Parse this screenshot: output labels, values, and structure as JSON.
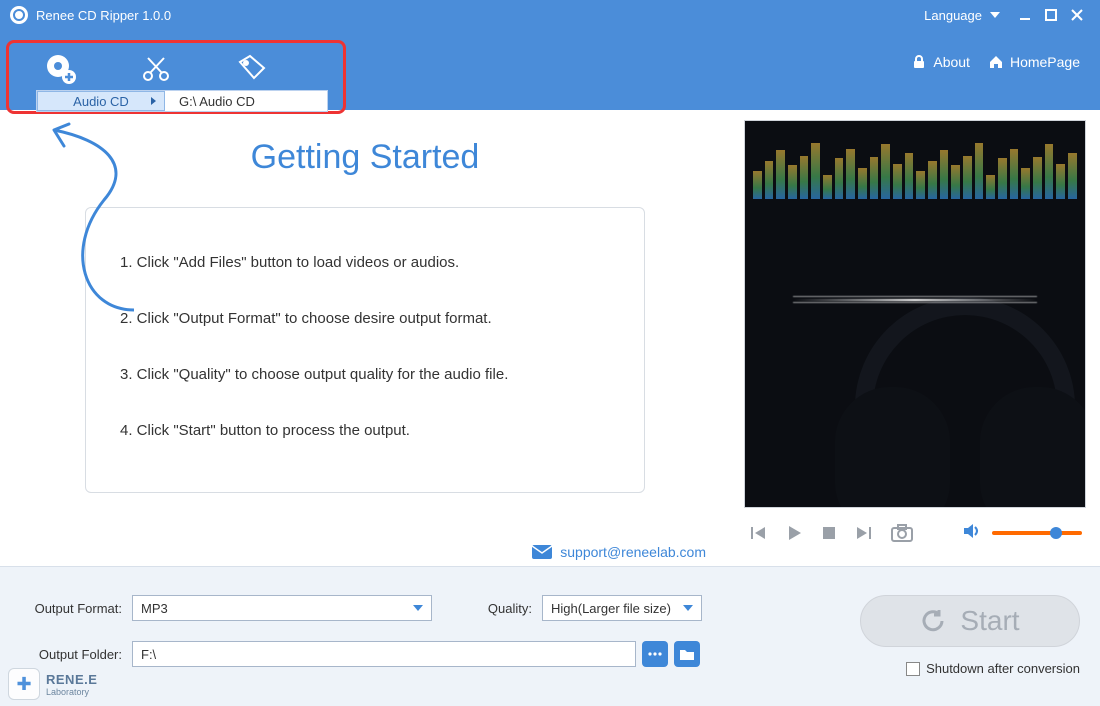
{
  "app": {
    "title": "Renee CD Ripper 1.0.0",
    "language_label": "Language"
  },
  "ribbon": {
    "about": "About",
    "homepage": "HomePage",
    "submenu": {
      "left": "Audio CD",
      "right": "G:\\ Audio CD"
    }
  },
  "gettingStarted": {
    "title": "Getting Started",
    "steps": [
      "1. Click \"Add Files\" button to load videos or audios.",
      "2. Click \"Output Format\" to choose desire output format.",
      "3. Click \"Quality\" to choose output quality for the audio file.",
      "4. Click \"Start\" button to process the output."
    ]
  },
  "support_email": "support@reneelab.com",
  "output": {
    "format_label": "Output Format:",
    "format_value": "MP3",
    "quality_label": "Quality:",
    "quality_value": "High(Larger file size)",
    "folder_label": "Output Folder:",
    "folder_value": "F:\\"
  },
  "start": {
    "label": "Start",
    "shutdown_label": "Shutdown after conversion"
  },
  "watermark": {
    "line1": "RENE.E",
    "line2": "Laboratory"
  }
}
